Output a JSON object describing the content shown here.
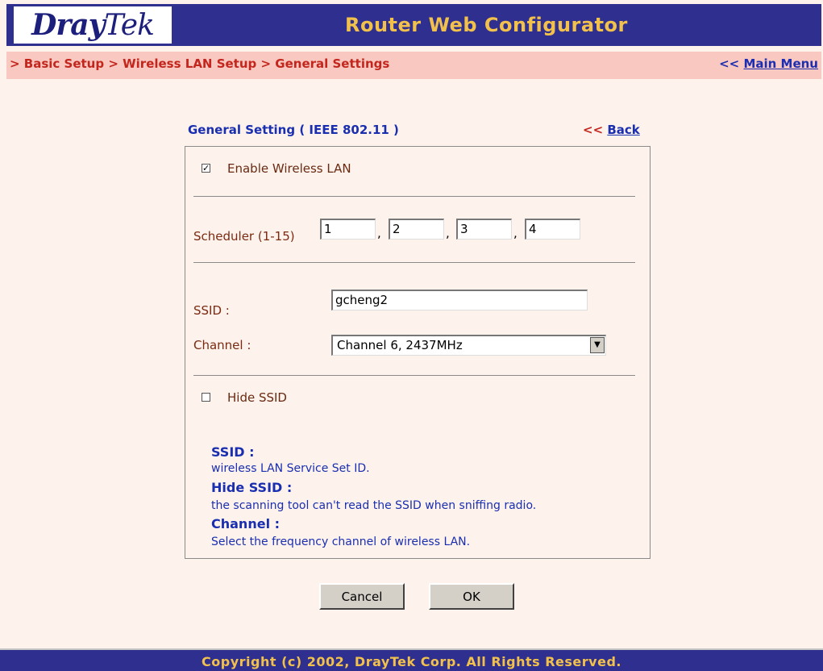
{
  "header": {
    "logo_part1": "Dray",
    "logo_part2": "Tek",
    "title": "Router Web Configurator"
  },
  "breadcrumb": {
    "path": "> Basic Setup > Wireless LAN Setup >  General Settings",
    "main_menu_prefix": "<< ",
    "main_menu_label": "Main Menu"
  },
  "section": {
    "title": "General Setting ( IEEE 802.11 )",
    "back_prefix": "<< ",
    "back_label": "Back"
  },
  "form": {
    "enable_wireless": {
      "checked": true,
      "label": "Enable Wireless LAN",
      "mark": "✓"
    },
    "scheduler": {
      "label": "Scheduler (1-15)",
      "separator": ",",
      "values": [
        "1",
        "2",
        "3",
        "4"
      ]
    },
    "ssid": {
      "label": "SSID :",
      "value": "gcheng2"
    },
    "channel": {
      "label": "Channel :",
      "value": "Channel 6, 2437MHz"
    },
    "hide_ssid": {
      "checked": false,
      "label": "Hide SSID"
    }
  },
  "help": {
    "ssid_term": "SSID :",
    "ssid_desc": "wireless LAN Service Set ID.",
    "hide_term": "Hide SSID :",
    "hide_desc": "the scanning tool can't read the SSID when sniffing radio.",
    "channel_term": "Channel :",
    "channel_desc": "Select the frequency channel of wireless LAN."
  },
  "buttons": {
    "cancel": "Cancel",
    "ok": "OK"
  },
  "footer": {
    "copyright": "Copyright (c) 2002, DrayTek Corp. All Rights Reserved."
  },
  "colors": {
    "header_bg": "#2e2f8f",
    "header_text": "#f2c14b",
    "breadcrumb_bg": "#f9c9c1",
    "breadcrumb_text": "#c3261d",
    "link": "#1a2fb0",
    "label": "#7b2a10",
    "page_bg": "#fdf2ec"
  }
}
